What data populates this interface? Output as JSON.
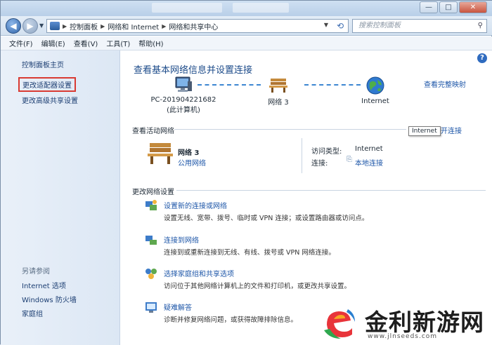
{
  "window": {
    "titlebar_buttons": [
      "—",
      "□",
      "✕"
    ]
  },
  "nav": {
    "back_icon": "back-arrow-icon",
    "forward_icon": "forward-arrow-icon",
    "breadcrumbs": [
      "控制面板",
      "网络和 Internet",
      "网络和共享中心"
    ],
    "search_placeholder": "搜索控制面板"
  },
  "menu": {
    "items": [
      "文件(F)",
      "编辑(E)",
      "查看(V)",
      "工具(T)",
      "帮助(H)"
    ]
  },
  "sidebar": {
    "top_links": [
      "控制面板主页",
      "更改适配器设置",
      "更改高级共享设置"
    ],
    "see_also_heading": "另请参阅",
    "see_also_links": [
      "Internet 选项",
      "Windows 防火墙",
      "家庭组"
    ]
  },
  "main": {
    "title": "查看基本网络信息并设置连接",
    "full_map_link": "查看完整映射",
    "nodes": [
      {
        "label": "PC-201904221682",
        "sublabel": "(此计算机)",
        "icon": "computer-icon"
      },
      {
        "label": "网络 3",
        "sublabel": "",
        "icon": "bench-icon"
      },
      {
        "label": "Internet",
        "sublabel": "",
        "icon": "globe-icon"
      }
    ],
    "active_networks_title": "查看活动网络",
    "connect_link": "连接或断开连接",
    "tooltip": "Internet",
    "network": {
      "name": "网络 3",
      "type": "公用网络",
      "access_type_label": "访问类型:",
      "access_type_value": "Internet",
      "connections_label": "连接:",
      "connections_value": "本地连接"
    },
    "change_settings_title": "更改网络设置",
    "tasks": [
      {
        "link": "设置新的连接或网络",
        "desc": "设置无线、宽带、拨号、临时或 VPN 连接；或设置路由器或访问点。",
        "icon": "new-connection-icon"
      },
      {
        "link": "连接到网络",
        "desc": "连接到或重新连接到无线、有线、拨号或 VPN 网络连接。",
        "icon": "connect-network-icon"
      },
      {
        "link": "选择家庭组和共享选项",
        "desc": "访问位于其他网络计算机上的文件和打印机，或更改共享设置。",
        "icon": "homegroup-icon"
      },
      {
        "link": "疑难解答",
        "desc": "诊断并修复网络问题，或获得故障排除信息。",
        "icon": "troubleshoot-icon"
      }
    ]
  },
  "watermark": {
    "text": "金利新游网",
    "url": "www.jlnseeds.com"
  }
}
